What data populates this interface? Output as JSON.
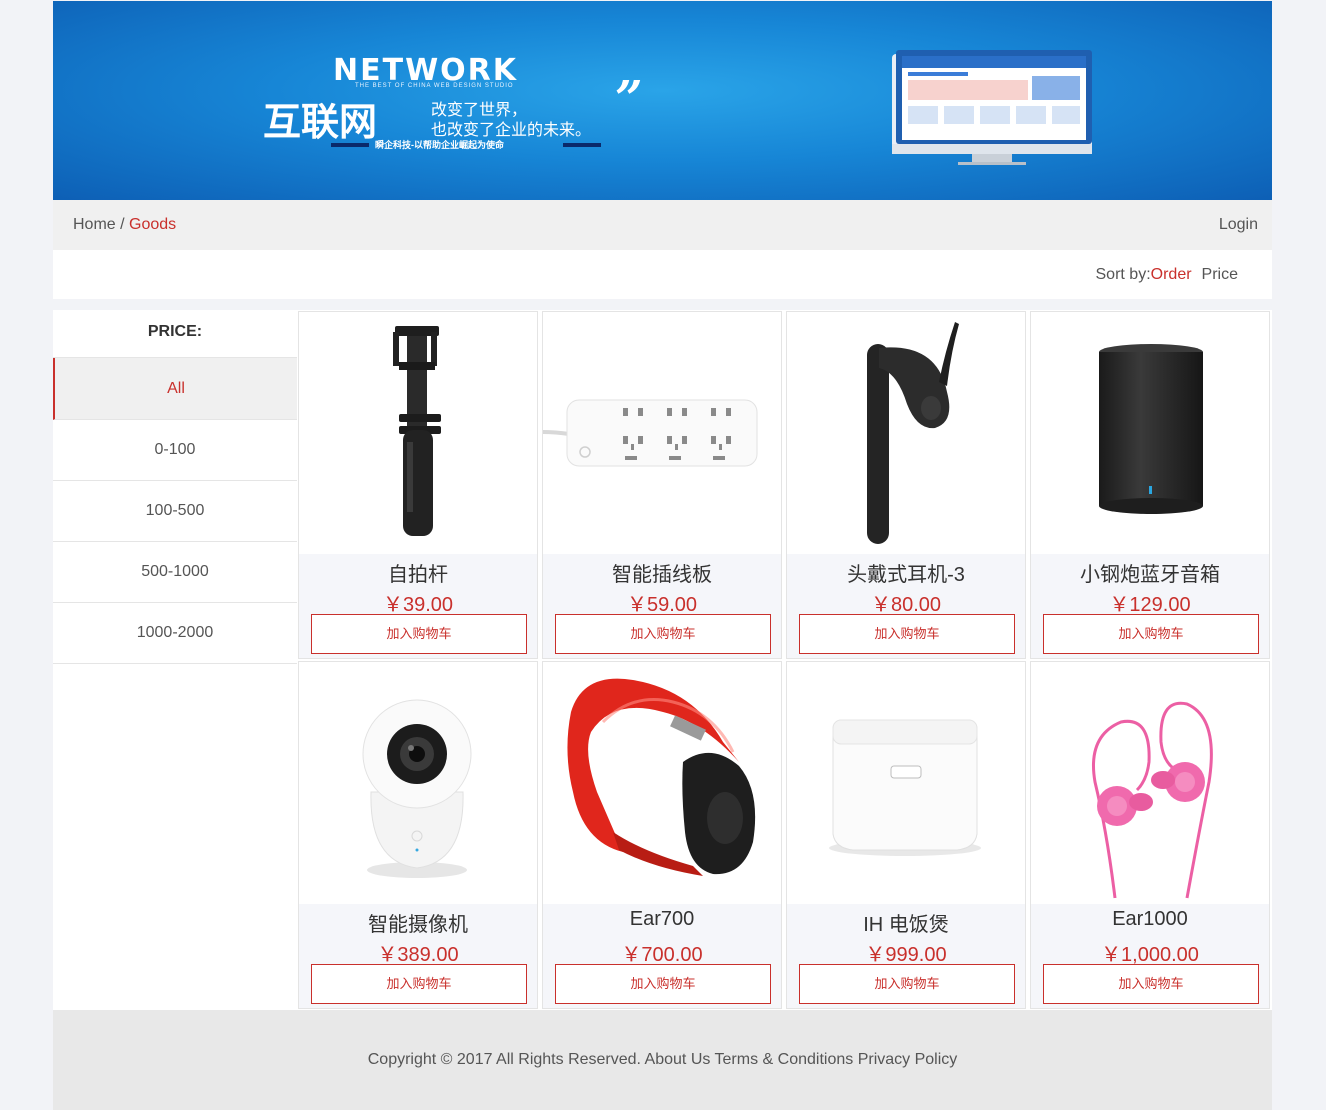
{
  "banner": {
    "headline": "NETWORK",
    "subline": "THE BEST OF CHINA WEB DESIGN STUDIO",
    "cn_title": "互联网",
    "cn_line1": "改变了世界，",
    "cn_line2": "也改变了企业的未来。",
    "tagline": "瞬企科技-以帮助企业崛起为使命",
    "quote": "”"
  },
  "breadcrumb": {
    "home": "Home",
    "separator": " / ",
    "current": "Goods"
  },
  "header": {
    "login": "Login"
  },
  "sort": {
    "label": "Sort by:",
    "order": "Order",
    "price": "Price"
  },
  "filter": {
    "title": "PRICE:",
    "items": [
      "All",
      "0-100",
      "100-500",
      "500-1000",
      "1000-2000"
    ],
    "active": "All"
  },
  "products": [
    {
      "name": "自拍杆",
      "price": "￥39.00",
      "button": "加入购物车",
      "icon": "selfie-stick-icon"
    },
    {
      "name": "智能插线板",
      "price": "￥59.00",
      "button": "加入购物车",
      "icon": "power-strip-icon"
    },
    {
      "name": "头戴式耳机-3",
      "price": "￥80.00",
      "button": "加入购物车",
      "icon": "bluetooth-earpiece-icon"
    },
    {
      "name": "小钢炮蓝牙音箱",
      "price": "￥129.00",
      "button": "加入购物车",
      "icon": "speaker-icon"
    },
    {
      "name": "智能摄像机",
      "price": "￥389.00",
      "button": "加入购物车",
      "icon": "camera-icon"
    },
    {
      "name": "Ear700",
      "price": "￥700.00",
      "button": "加入购物车",
      "icon": "headphones-icon"
    },
    {
      "name": "IH 电饭煲",
      "price": "￥999.00",
      "button": "加入购物车",
      "icon": "rice-cooker-icon"
    },
    {
      "name": "Ear1000",
      "price": "￥1,000.00",
      "button": "加入购物车",
      "icon": "earphones-icon"
    }
  ],
  "footer": {
    "copyright": "Copyright © 2017 All Rights Reserved. About Us Terms & Conditions Privacy Policy"
  },
  "colors": {
    "accent": "#c9302c",
    "banner_blue": "#1786d6"
  }
}
